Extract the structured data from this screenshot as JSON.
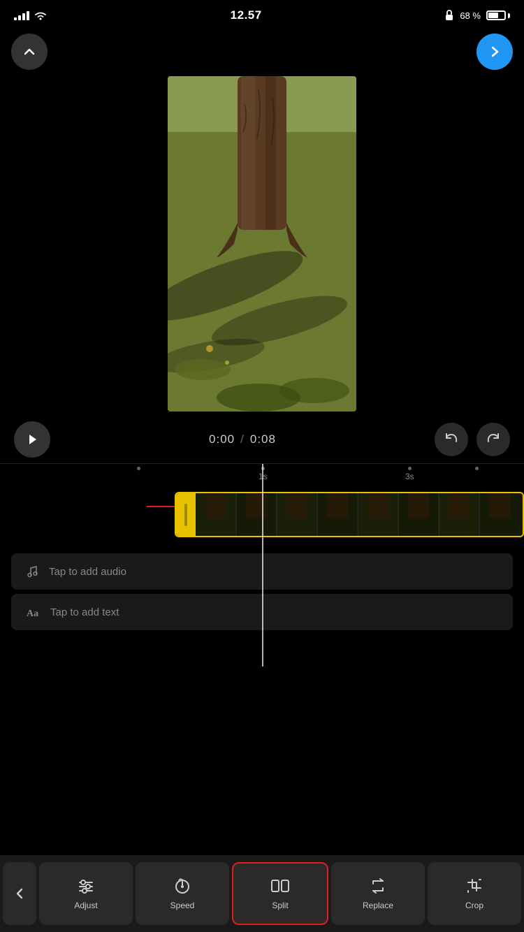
{
  "status_bar": {
    "time": "12.57",
    "battery_percent": "68 %",
    "signal_bars": [
      4,
      7,
      10,
      13
    ],
    "lock_icon": "🔒"
  },
  "header": {
    "back_label": "↑",
    "next_label": "→"
  },
  "video": {
    "current_time": "0:00",
    "separator": "/",
    "total_time": "0:08"
  },
  "timeline": {
    "ruler_marks": [
      {
        "label": "1s",
        "position": 380
      },
      {
        "label": "3s",
        "position": 590
      }
    ],
    "audio_placeholder": "Tap to add audio",
    "text_placeholder": "Tap to add text"
  },
  "toolbar": {
    "back_label": "<",
    "items": [
      {
        "id": "adjust",
        "label": "Adjust",
        "icon": "sliders"
      },
      {
        "id": "speed",
        "label": "Speed",
        "icon": "speed"
      },
      {
        "id": "split",
        "label": "Split",
        "icon": "split",
        "active": true
      },
      {
        "id": "replace",
        "label": "Replace",
        "icon": "replace"
      },
      {
        "id": "crop",
        "label": "Crop",
        "icon": "crop"
      }
    ]
  }
}
